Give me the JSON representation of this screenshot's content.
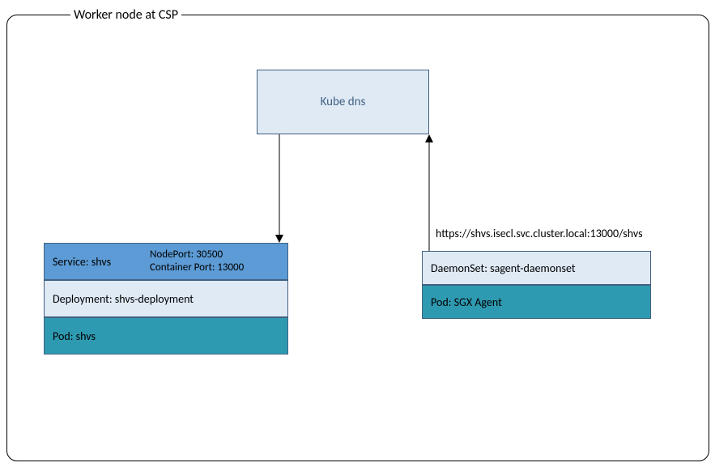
{
  "frame": {
    "title": "Worker node at CSP"
  },
  "kube_dns": {
    "label": "Kube dns"
  },
  "left_stack": {
    "service": {
      "label": "Service: shvs",
      "nodeport": "NodePort: 30500",
      "container_port": "Container Port: 13000"
    },
    "deployment": {
      "label": "Deployment: shvs-deployment"
    },
    "pod": {
      "label": "Pod: shvs"
    }
  },
  "right_stack": {
    "url": "https://shvs.isecl.svc.cluster.local:13000/shvs",
    "daemonset": {
      "label": "DaemonSet: sagent-daemonset"
    },
    "pod": {
      "label": "Pod: SGX Agent"
    }
  }
}
